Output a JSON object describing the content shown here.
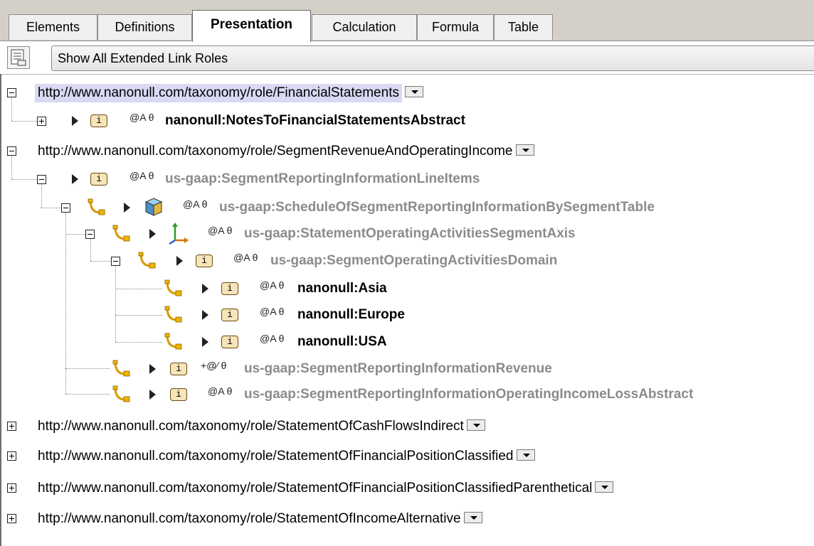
{
  "tabs": [
    "Elements",
    "Definitions",
    "Presentation",
    "Calculation",
    "Formula",
    "Table"
  ],
  "active_tab": "Presentation",
  "toolbar": {
    "button_label": "Show All Extended Link Roles"
  },
  "tree": {
    "roles": [
      "http://www.nanonull.com/taxonomy/role/FinancialStatements",
      "http://www.nanonull.com/taxonomy/role/SegmentRevenueAndOperatingIncome",
      "http://www.nanonull.com/taxonomy/role/StatementOfCashFlowsIndirect",
      "http://www.nanonull.com/taxonomy/role/StatementOfFinancialPositionClassified",
      "http://www.nanonull.com/taxonomy/role/StatementOfFinancialPositionClassifiedParenthetical",
      "http://www.nanonull.com/taxonomy/role/StatementOfIncomeAlternative"
    ],
    "nodes": [
      {
        "label": "nanonull:NotesToFinancialStatementsAbstract",
        "attrs": "@A θ"
      },
      {
        "label": "us-gaap:SegmentReportingInformationLineItems",
        "attrs": "@A θ"
      },
      {
        "label": "us-gaap:ScheduleOfSegmentReportingInformationBySegmentTable",
        "attrs": "@A θ"
      },
      {
        "label": "us-gaap:StatementOperatingActivitiesSegmentAxis",
        "attrs": "@A θ"
      },
      {
        "label": "us-gaap:SegmentOperatingActivitiesDomain",
        "attrs": "@A θ"
      },
      {
        "label": "nanonull:Asia",
        "attrs": "@A θ"
      },
      {
        "label": "nanonull:Europe",
        "attrs": "@A θ"
      },
      {
        "label": "nanonull:USA",
        "attrs": "@A θ"
      },
      {
        "label": "us-gaap:SegmentReportingInformationRevenue",
        "attrs": "+@∕ θ"
      },
      {
        "label": "us-gaap:SegmentReportingInformationOperatingIncomeLossAbstract",
        "attrs": "@A θ"
      }
    ],
    "item_icon_text": "i"
  },
  "icons": {
    "toolbar": "list-view-icon",
    "expand": "expand-icon",
    "collapse": "collapse-icon",
    "dropdown": "dropdown-arrow-icon",
    "arrow": "triangle-right-icon",
    "item": "item-icon",
    "hook": "arc-hook-icon",
    "hypercube": "hypercube-icon",
    "dimension": "dimension-axis-icon"
  },
  "colors": {
    "selected_role_bg": "#d9d9f3",
    "dim_label": "#8b8b8b",
    "item_icon_bg": "#f7e4b8"
  }
}
